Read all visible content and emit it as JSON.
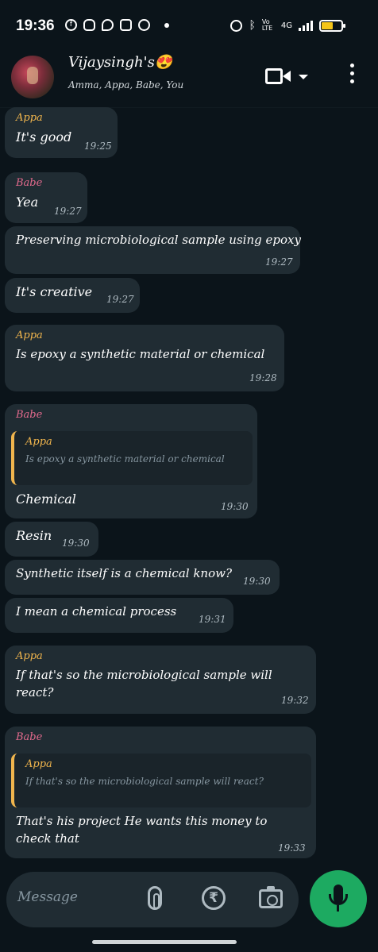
{
  "status_bar": {
    "time": "19:36",
    "network_label": "Vo LTE",
    "network_type": "4G",
    "battery_level": 0.6
  },
  "header": {
    "title": "Vijaysingh's😍",
    "subtitle": "Amma, Appa, Babe, You"
  },
  "messages": [
    {
      "sender": "Appa",
      "text": "It's good",
      "time": "19:25"
    },
    {
      "sender": "Babe",
      "text": "Yea",
      "time": "19:27"
    },
    {
      "sender": "",
      "text": "Preserving microbiological sample using epoxy",
      "time": "19:27"
    },
    {
      "sender": "",
      "text": "It's creative",
      "time": "19:27"
    },
    {
      "sender": "Appa",
      "text": "Is epoxy a synthetic material or chemical",
      "time": "19:28"
    },
    {
      "sender": "Babe",
      "quote_sender": "Appa",
      "quote_text": "Is epoxy a synthetic material or chemical",
      "text": "Chemical",
      "time": "19:30"
    },
    {
      "sender": "",
      "text": "Resin",
      "time": "19:30"
    },
    {
      "sender": "",
      "text": "Synthetic itself is a chemical know?",
      "time": "19:30"
    },
    {
      "sender": "",
      "text": "I mean a chemical process",
      "time": "19:31"
    },
    {
      "sender": "Appa",
      "text_line1": "If that's so the microbiological sample will",
      "text_line2": "react?",
      "time": "19:32"
    },
    {
      "sender": "Babe",
      "quote_sender": "Appa",
      "quote_text": "If that's so the microbiological sample will react?",
      "text_line1": "That's his project He wants this money to",
      "text_line2": "check that",
      "time": "19:33"
    }
  ],
  "composer": {
    "placeholder": "Message",
    "rupee_symbol": "₹"
  },
  "colors": {
    "background": "#0b141a",
    "bubble": "#202c33",
    "appa": "#f0b54d",
    "babe": "#e26a8d",
    "send_button": "#1daa61"
  }
}
